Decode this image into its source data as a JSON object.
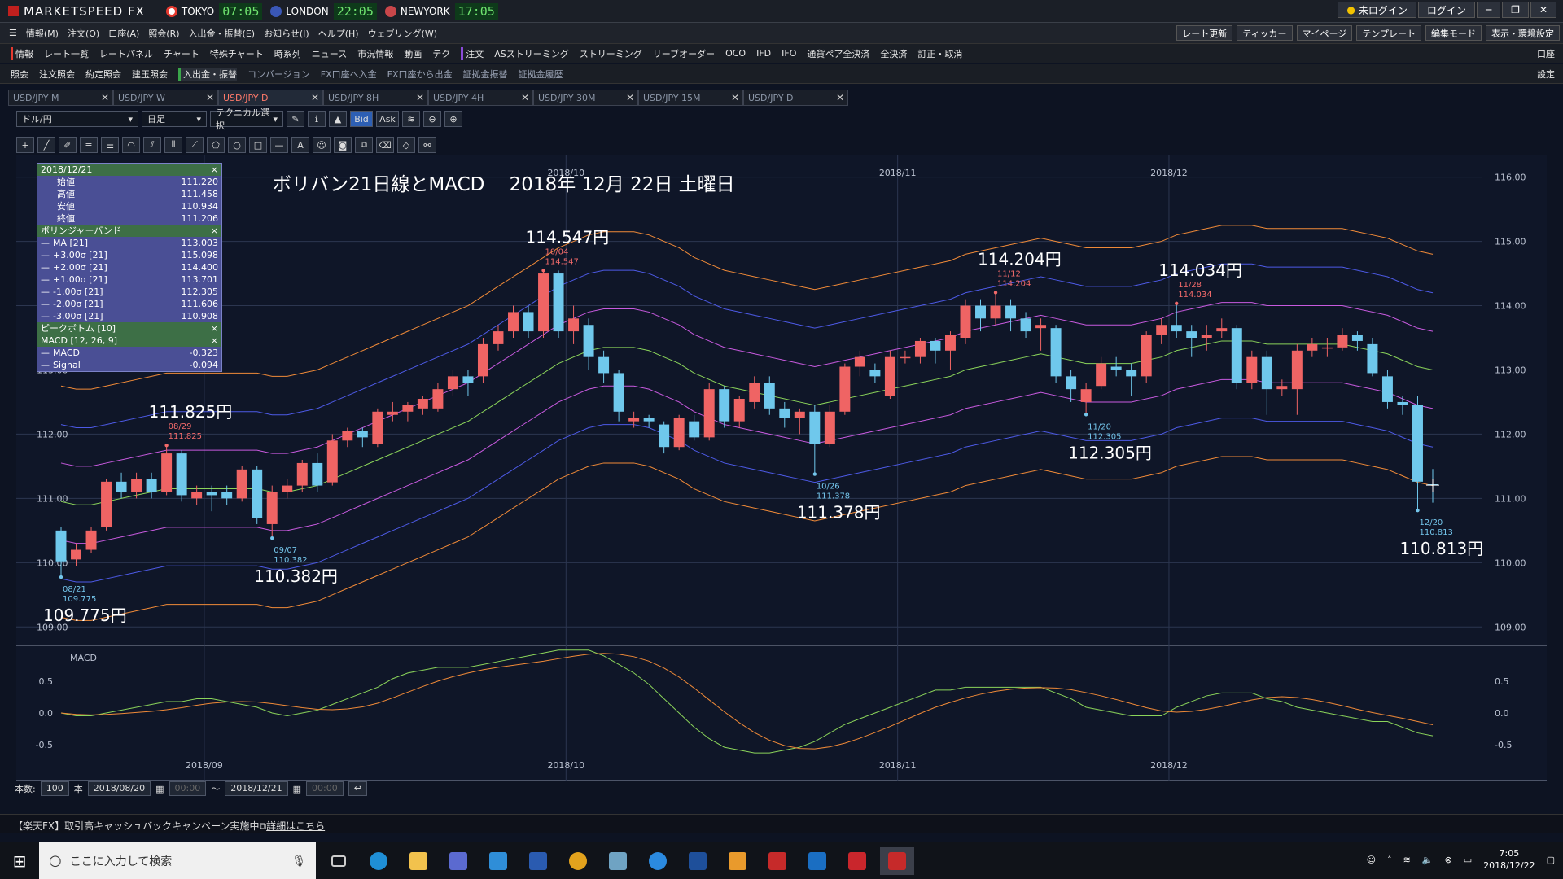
{
  "app": {
    "name": "MARKETSPEED FX",
    "markets": [
      {
        "name": "TOKYO",
        "time": "07:05",
        "color": "#e53a30"
      },
      {
        "name": "LONDON",
        "time": "22:05",
        "color": "#3a57b7"
      },
      {
        "name": "NEWYORK",
        "time": "17:05",
        "color": "#c9464a"
      }
    ],
    "login_status": "未ログイン",
    "login": "ログイン"
  },
  "menu": {
    "items": [
      "情報(M)",
      "注文(O)",
      "口座(A)",
      "照会(R)",
      "入出金・振替(E)",
      "お知らせ(I)",
      "ヘルプ(H)",
      "ウェブリング(W)"
    ],
    "right": [
      "レート更新",
      "ティッカー",
      "マイページ",
      "テンプレート",
      "編集モード",
      "表示・環境設定"
    ]
  },
  "toolbar1": {
    "items": [
      "情報",
      "レート一覧",
      "レートパネル",
      "チャート",
      "特殊チャート",
      "時系列",
      "ニュース",
      "市況情報",
      "動画",
      "テク",
      "注文",
      "ASストリーミング",
      "ストリーミング",
      "リーブオーダー",
      "OCO",
      "IFD",
      "IFO",
      "通貨ペア全決済",
      "全決済",
      "訂正・取消"
    ],
    "right": "口座"
  },
  "toolbar2": {
    "items": [
      "照会",
      "注文照会",
      "約定照会",
      "建玉照会",
      "入出金・振替",
      "コンバージョン",
      "FX口座へ入金",
      "FX口座から出金",
      "証拠金振替",
      "証拠金履歴"
    ],
    "right": "設定"
  },
  "tabs": [
    "USD/JPY M",
    "USD/JPY W",
    "USD/JPY D",
    "USD/JPY 8H",
    "USD/JPY 4H",
    "USD/JPY 30M",
    "USD/JPY 15M",
    "USD/JPY D"
  ],
  "active_tab": 2,
  "chart_toolbar": {
    "pair": "ドル/円",
    "period": "日足",
    "tech": "テクニカル選択",
    "bid": "Bid",
    "ask": "Ask"
  },
  "status": {
    "count_label": "本数:",
    "count": "100",
    "unit": "本",
    "from": "2018/08/20",
    "from_time": "00:00",
    "to": "2018/12/21",
    "to_time": "00:00",
    "sep": "〜"
  },
  "ticker": {
    "text": "【楽天FX】取引高キャッシュバックキャンペーン実施中",
    "link": "詳細はこちら"
  },
  "taskbar": {
    "search": "ここに入力して検索",
    "time": "7:05",
    "date": "2018/12/22"
  },
  "chart_data": {
    "type": "candlestick",
    "title": "ボリバン21日線とMACD　 2018年 12月 22日 土曜日",
    "info": {
      "date": "2018/12/21",
      "ohlc": [
        [
          "始値",
          "111.220"
        ],
        [
          "高値",
          "111.458"
        ],
        [
          "安値",
          "110.934"
        ],
        [
          "終値",
          "111.206"
        ]
      ],
      "bb_title": "ボリンジャーバンド",
      "bb": [
        [
          "MA [21]",
          "113.003"
        ],
        [
          "+3.00σ [21]",
          "115.098"
        ],
        [
          "+2.00σ [21]",
          "114.400"
        ],
        [
          "+1.00σ [21]",
          "113.701"
        ],
        [
          "-1.00σ [21]",
          "112.305"
        ],
        [
          "-2.00σ [21]",
          "111.606"
        ],
        [
          "-3.00σ [21]",
          "110.908"
        ]
      ],
      "pb_title": "ピークボトム [10]",
      "macd_title": "MACD [12, 26, 9]",
      "macd": [
        [
          "MACD",
          "-0.323"
        ],
        [
          "Signal",
          "-0.094"
        ]
      ]
    },
    "y_ticks": [
      "116.00",
      "115.00",
      "114.00",
      "113.00",
      "112.00",
      "111.00",
      "110.00",
      "109.00"
    ],
    "ylim": [
      108.75,
      116.35
    ],
    "x_labels": [
      "2018/09",
      "2018/10",
      "2018/11",
      "2018/12"
    ],
    "macd_ticks": [
      "0.5",
      "0.0",
      "-0.5"
    ],
    "macd_label": "MACD",
    "candles": [
      [
        110.5,
        110.02,
        110.55,
        109.775
      ],
      [
        110.05,
        110.2,
        110.3,
        109.95
      ],
      [
        110.2,
        110.5,
        110.55,
        110.15
      ],
      [
        110.55,
        111.26,
        111.3,
        110.5
      ],
      [
        111.26,
        111.1,
        111.4,
        111.0
      ],
      [
        111.1,
        111.3,
        111.4,
        111.0
      ],
      [
        111.3,
        111.1,
        111.4,
        111.0
      ],
      [
        111.1,
        111.7,
        111.825,
        111.05
      ],
      [
        111.7,
        111.05,
        111.75,
        110.95
      ],
      [
        111.0,
        111.1,
        111.2,
        110.9
      ],
      [
        111.1,
        111.05,
        111.2,
        110.8
      ],
      [
        111.1,
        111.0,
        111.2,
        110.9
      ],
      [
        111.0,
        111.45,
        111.5,
        110.95
      ],
      [
        111.45,
        110.7,
        111.5,
        110.6
      ],
      [
        110.6,
        111.1,
        111.2,
        110.382
      ],
      [
        111.1,
        111.2,
        111.3,
        111.0
      ],
      [
        111.2,
        111.55,
        111.6,
        111.1
      ],
      [
        111.55,
        111.2,
        111.7,
        111.1
      ],
      [
        111.25,
        111.9,
        112.0,
        111.2
      ],
      [
        111.9,
        112.05,
        112.1,
        111.8
      ],
      [
        112.05,
        111.95,
        112.1,
        111.8
      ],
      [
        111.85,
        112.35,
        112.4,
        111.8
      ],
      [
        112.3,
        112.35,
        112.5,
        112.2
      ],
      [
        112.35,
        112.45,
        112.5,
        112.2
      ],
      [
        112.4,
        112.55,
        112.6,
        112.3
      ],
      [
        112.4,
        112.7,
        112.8,
        112.35
      ],
      [
        112.7,
        112.9,
        113.0,
        112.6
      ],
      [
        112.9,
        112.8,
        113.0,
        112.6
      ],
      [
        112.9,
        113.4,
        113.5,
        112.8
      ],
      [
        113.4,
        113.6,
        113.7,
        113.3
      ],
      [
        113.6,
        113.9,
        114.0,
        113.5
      ],
      [
        113.9,
        113.6,
        114.0,
        113.5
      ],
      [
        113.6,
        114.5,
        114.547,
        113.5
      ],
      [
        114.5,
        113.6,
        114.547,
        113.5
      ],
      [
        113.6,
        113.8,
        114.0,
        113.4
      ],
      [
        113.7,
        113.2,
        113.8,
        113.0
      ],
      [
        113.2,
        112.95,
        113.3,
        112.8
      ],
      [
        112.95,
        112.35,
        113.0,
        112.2
      ],
      [
        112.2,
        112.25,
        112.35,
        112.1
      ],
      [
        112.25,
        112.2,
        112.3,
        112.1
      ],
      [
        112.15,
        111.8,
        112.2,
        111.7
      ],
      [
        111.8,
        112.25,
        112.3,
        111.75
      ],
      [
        112.2,
        111.95,
        112.3,
        111.9
      ],
      [
        111.95,
        112.7,
        112.8,
        111.9
      ],
      [
        112.7,
        112.2,
        112.75,
        112.1
      ],
      [
        112.2,
        112.55,
        112.6,
        112.1
      ],
      [
        112.5,
        112.8,
        112.9,
        112.4
      ],
      [
        112.8,
        112.4,
        112.9,
        112.3
      ],
      [
        112.4,
        112.25,
        112.5,
        112.1
      ],
      [
        112.25,
        112.35,
        112.4,
        112.0
      ],
      [
        112.35,
        111.85,
        112.45,
        111.378
      ],
      [
        111.85,
        112.35,
        112.45,
        111.8
      ],
      [
        112.35,
        113.05,
        113.1,
        112.3
      ],
      [
        113.05,
        113.2,
        113.3,
        112.9
      ],
      [
        113.0,
        112.9,
        113.1,
        112.8
      ],
      [
        112.6,
        113.2,
        113.3,
        112.55
      ],
      [
        113.2,
        113.2,
        113.3,
        113.1
      ],
      [
        113.2,
        113.45,
        113.5,
        113.1
      ],
      [
        113.45,
        113.3,
        113.5,
        113.1
      ],
      [
        113.3,
        113.55,
        113.6,
        113.0
      ],
      [
        113.5,
        114.0,
        114.1,
        113.4
      ],
      [
        114.0,
        113.8,
        114.1,
        113.6
      ],
      [
        113.8,
        114.0,
        114.204,
        113.7
      ],
      [
        114.0,
        113.8,
        114.1,
        113.6
      ],
      [
        113.8,
        113.6,
        113.9,
        113.5
      ],
      [
        113.65,
        113.7,
        113.8,
        113.3
      ],
      [
        113.65,
        112.9,
        113.7,
        112.8
      ],
      [
        112.9,
        112.7,
        113.0,
        112.5
      ],
      [
        112.5,
        112.7,
        112.8,
        112.305
      ],
      [
        112.75,
        113.1,
        113.2,
        112.7
      ],
      [
        113.05,
        113.0,
        113.2,
        112.9
      ],
      [
        113.0,
        112.9,
        113.1,
        112.6
      ],
      [
        112.9,
        113.55,
        113.6,
        112.8
      ],
      [
        113.55,
        113.7,
        113.8,
        113.4
      ],
      [
        113.7,
        113.6,
        114.034,
        113.5
      ],
      [
        113.6,
        113.5,
        113.7,
        113.2
      ],
      [
        113.5,
        113.55,
        113.7,
        113.3
      ],
      [
        113.6,
        113.65,
        113.8,
        113.5
      ],
      [
        113.65,
        112.8,
        113.7,
        112.7
      ],
      [
        112.8,
        113.2,
        113.3,
        112.7
      ],
      [
        113.2,
        112.7,
        113.3,
        112.3
      ],
      [
        112.7,
        112.75,
        112.85,
        112.6
      ],
      [
        112.7,
        113.3,
        113.4,
        112.3
      ],
      [
        113.3,
        113.4,
        113.5,
        113.2
      ],
      [
        113.35,
        113.35,
        113.5,
        113.2
      ],
      [
        113.35,
        113.55,
        113.65,
        113.3
      ],
      [
        113.55,
        113.45,
        113.6,
        113.3
      ],
      [
        113.4,
        112.95,
        113.5,
        112.9
      ],
      [
        112.9,
        112.5,
        113.0,
        112.4
      ],
      [
        112.5,
        112.45,
        112.6,
        112.3
      ],
      [
        112.45,
        111.26,
        112.6,
        110.813
      ],
      [
        111.22,
        111.206,
        111.458,
        110.934
      ]
    ],
    "bands": {
      "mid": [
        110.95,
        110.9,
        110.9,
        110.95,
        111.0,
        111.05,
        111.1,
        111.15,
        111.15,
        111.15,
        111.15,
        111.15,
        111.15,
        111.15,
        111.1,
        111.1,
        111.15,
        111.2,
        111.3,
        111.4,
        111.5,
        111.6,
        111.7,
        111.8,
        111.9,
        112.0,
        112.1,
        112.2,
        112.35,
        112.5,
        112.65,
        112.8,
        112.95,
        113.1,
        113.2,
        113.3,
        113.35,
        113.35,
        113.35,
        113.3,
        113.2,
        113.1,
        112.95,
        112.85,
        112.75,
        112.7,
        112.65,
        112.6,
        112.55,
        112.5,
        112.45,
        112.5,
        112.55,
        112.6,
        112.65,
        112.7,
        112.75,
        112.8,
        112.85,
        112.9,
        113.0,
        113.05,
        113.1,
        113.15,
        113.2,
        113.25,
        113.2,
        113.15,
        113.1,
        113.1,
        113.1,
        113.1,
        113.15,
        113.2,
        113.3,
        113.35,
        113.4,
        113.45,
        113.45,
        113.45,
        113.4,
        113.4,
        113.4,
        113.4,
        113.4,
        113.4,
        113.35,
        113.3,
        113.25,
        113.15,
        113.05,
        113.0
      ],
      "s1": 0.6,
      "s2": 1.2,
      "s3": 1.8
    },
    "labels": [
      {
        "i": 0,
        "price": "109.775円",
        "date": "08/21",
        "val": "109.775",
        "pos": "below"
      },
      {
        "i": 7,
        "price": "111.825円",
        "date": "08/29",
        "val": "111.825",
        "pos": "above"
      },
      {
        "i": 14,
        "price": "110.382円",
        "date": "09/07",
        "val": "110.382",
        "pos": "below"
      },
      {
        "i": 32,
        "price": "114.547円",
        "date": "10/04",
        "val": "114.547",
        "pos": "above"
      },
      {
        "i": 50,
        "price": "111.378円",
        "date": "10/26",
        "val": "111.378",
        "pos": "below"
      },
      {
        "i": 62,
        "price": "114.204円",
        "date": "11/12",
        "val": "114.204",
        "pos": "above"
      },
      {
        "i": 68,
        "price": "112.305円",
        "date": "11/20",
        "val": "112.305",
        "pos": "below"
      },
      {
        "i": 74,
        "price": "114.034円",
        "date": "11/28",
        "val": "114.034",
        "pos": "above"
      },
      {
        "i": 90,
        "price": "110.813円",
        "date": "12/20",
        "val": "110.813",
        "pos": "below"
      }
    ]
  },
  "colors": {
    "up": "#ef6464",
    "down": "#6fc8ec",
    "mid": "#8bd45a",
    "s1": "#c85adf",
    "s2": "#4d5ae6",
    "s3": "#f08a38",
    "macd": "#8bd45a",
    "signal": "#f08a38"
  }
}
